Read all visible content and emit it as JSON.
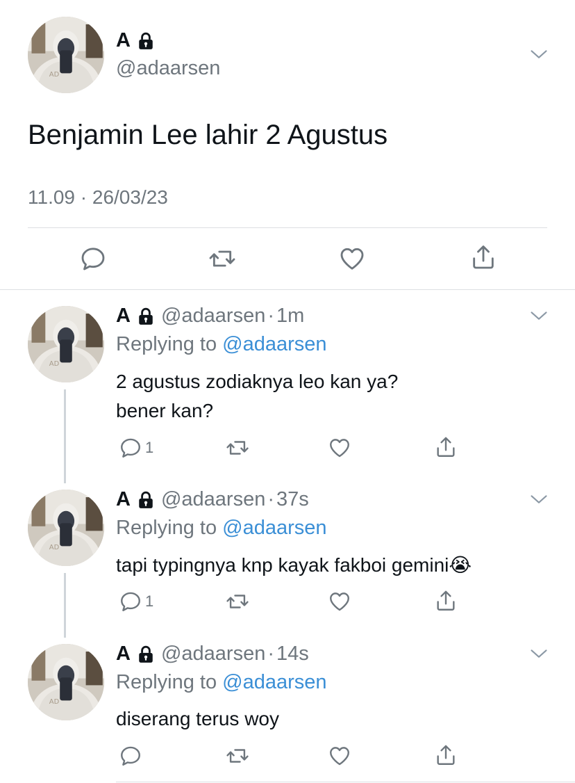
{
  "main_tweet": {
    "display_name": "A",
    "handle": "@adaarsen",
    "text": "Benjamin Lee lahir 2 Agustus",
    "timestamp": "11.09 · 26/03/23"
  },
  "replies": [
    {
      "display_name": "A",
      "handle": "@adaarsen",
      "time": "1m",
      "replying_prefix": "Replying to",
      "replying_to": "@adaarsen",
      "text_line1": "2 agustus zodiaknya leo kan ya?",
      "text_line2": "bener kan?",
      "reply_count": "1"
    },
    {
      "display_name": "A",
      "handle": "@adaarsen",
      "time": "37s",
      "replying_prefix": "Replying to",
      "replying_to": "@adaarsen",
      "text_line1": "tapi typingnya knp kayak fakboi gemini😭",
      "reply_count": "1"
    },
    {
      "display_name": "A",
      "handle": "@adaarsen",
      "time": "14s",
      "replying_prefix": "Replying to",
      "replying_to": "@adaarsen",
      "text_line1": "diserang terus woy",
      "reply_count": ""
    }
  ],
  "separator": "·",
  "colors": {
    "link": "#3b8fd6",
    "muted": "#6e767d",
    "divider": "#dcdfe2",
    "thread_line": "#cfd5da"
  },
  "icons": [
    "lock-icon",
    "chevron-down-icon",
    "reply-icon",
    "retweet-icon",
    "like-icon",
    "share-icon"
  ]
}
